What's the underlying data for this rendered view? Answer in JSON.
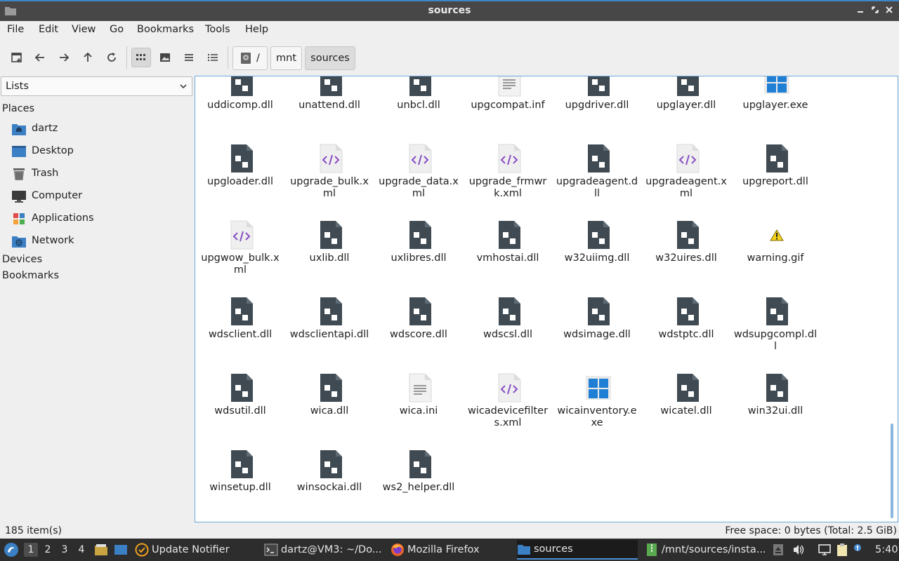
{
  "window": {
    "title": "sources",
    "controls": [
      "minimize-icon",
      "maximize-icon",
      "close-icon"
    ]
  },
  "menu": [
    "File",
    "Edit",
    "View",
    "Go",
    "Bookmarks",
    "Tools",
    "Help"
  ],
  "toolbar": {
    "buttons": [
      "new-tab-icon",
      "back-arrow-icon",
      "forward-arrow-icon",
      "up-arrow-icon",
      "reload-icon",
      "icon-view-icon",
      "thumbnail-view-icon",
      "compact-view-icon",
      "detailed-list-view-icon"
    ],
    "active_view": "icon-view-icon",
    "breadcrumbs": [
      "/",
      "mnt",
      "sources"
    ]
  },
  "sidebar": {
    "mode": "Lists",
    "places_heading": "Places",
    "places": [
      {
        "label": "dartz",
        "icon": "home-folder-icon"
      },
      {
        "label": "Desktop",
        "icon": "desktop-icon"
      },
      {
        "label": "Trash",
        "icon": "trash-icon"
      },
      {
        "label": "Computer",
        "icon": "computer-icon"
      },
      {
        "label": "Applications",
        "icon": "applications-icon"
      },
      {
        "label": "Network",
        "icon": "network-icon"
      }
    ],
    "devices_heading": "Devices",
    "bookmarks_heading": "Bookmarks"
  },
  "files": [
    {
      "name": "uddicomp.dll",
      "type": "dll"
    },
    {
      "name": "unattend.dll",
      "type": "dll"
    },
    {
      "name": "unbcl.dll",
      "type": "dll"
    },
    {
      "name": "upgcompat.inf",
      "type": "text"
    },
    {
      "name": "upgdriver.dll",
      "type": "dll"
    },
    {
      "name": "upglayer.dll",
      "type": "dll"
    },
    {
      "name": "upglayer.exe",
      "type": "exe"
    },
    {
      "name": "upgloader.dll",
      "type": "dll"
    },
    {
      "name": "upgrade_bulk.xml",
      "type": "xml"
    },
    {
      "name": "upgrade_data.xml",
      "type": "xml"
    },
    {
      "name": "upgrade_frmwrk.xml",
      "type": "xml"
    },
    {
      "name": "upgradeagent.dll",
      "type": "dll"
    },
    {
      "name": "upgradeagent.xml",
      "type": "xml"
    },
    {
      "name": "upgreport.dll",
      "type": "dll"
    },
    {
      "name": "upgwow_bulk.xml",
      "type": "xml"
    },
    {
      "name": "uxlib.dll",
      "type": "dll"
    },
    {
      "name": "uxlibres.dll",
      "type": "dll"
    },
    {
      "name": "vmhostai.dll",
      "type": "dll"
    },
    {
      "name": "w32uiimg.dll",
      "type": "dll"
    },
    {
      "name": "w32uires.dll",
      "type": "dll"
    },
    {
      "name": "warning.gif",
      "type": "warning"
    },
    {
      "name": "wdsclient.dll",
      "type": "dll"
    },
    {
      "name": "wdsclientapi.dll",
      "type": "dll"
    },
    {
      "name": "wdscore.dll",
      "type": "dll"
    },
    {
      "name": "wdscsl.dll",
      "type": "dll"
    },
    {
      "name": "wdsimage.dll",
      "type": "dll"
    },
    {
      "name": "wdstptc.dll",
      "type": "dll"
    },
    {
      "name": "wdsupgcompl.dll",
      "type": "dll"
    },
    {
      "name": "wdsutil.dll",
      "type": "dll"
    },
    {
      "name": "wica.dll",
      "type": "dll"
    },
    {
      "name": "wica.ini",
      "type": "text"
    },
    {
      "name": "wicadevicefilters.xml",
      "type": "xml"
    },
    {
      "name": "wicainventory.exe",
      "type": "exe"
    },
    {
      "name": "wicatel.dll",
      "type": "dll"
    },
    {
      "name": "win32ui.dll",
      "type": "dll"
    },
    {
      "name": "winsetup.dll",
      "type": "dll"
    },
    {
      "name": "winsockai.dll",
      "type": "dll"
    },
    {
      "name": "ws2_helper.dll",
      "type": "dll"
    }
  ],
  "status": {
    "count": "185 item(s)",
    "free_space": "Free space: 0 bytes (Total: 2.5 GiB)"
  },
  "taskbar": {
    "workspaces": [
      "1",
      "2",
      "3",
      "4"
    ],
    "active_workspace": "1",
    "tasks": [
      {
        "label": "Update Notifier",
        "icon": "update-notifier-icon"
      },
      {
        "label": "dartz@VM3: ~/Do...",
        "icon": "terminal-icon"
      },
      {
        "label": "Mozilla Firefox",
        "icon": "firefox-icon"
      },
      {
        "label": "sources",
        "icon": "folder-icon"
      },
      {
        "label": "/mnt/sources/insta...",
        "icon": "archive-icon"
      }
    ],
    "clock": "5:40",
    "colors": {
      "accent": "#4a90d9",
      "dll_icon": "#3f4a52",
      "xml_glyph": "#8a4fc6",
      "windows_blue": "#1f7fd4"
    }
  }
}
